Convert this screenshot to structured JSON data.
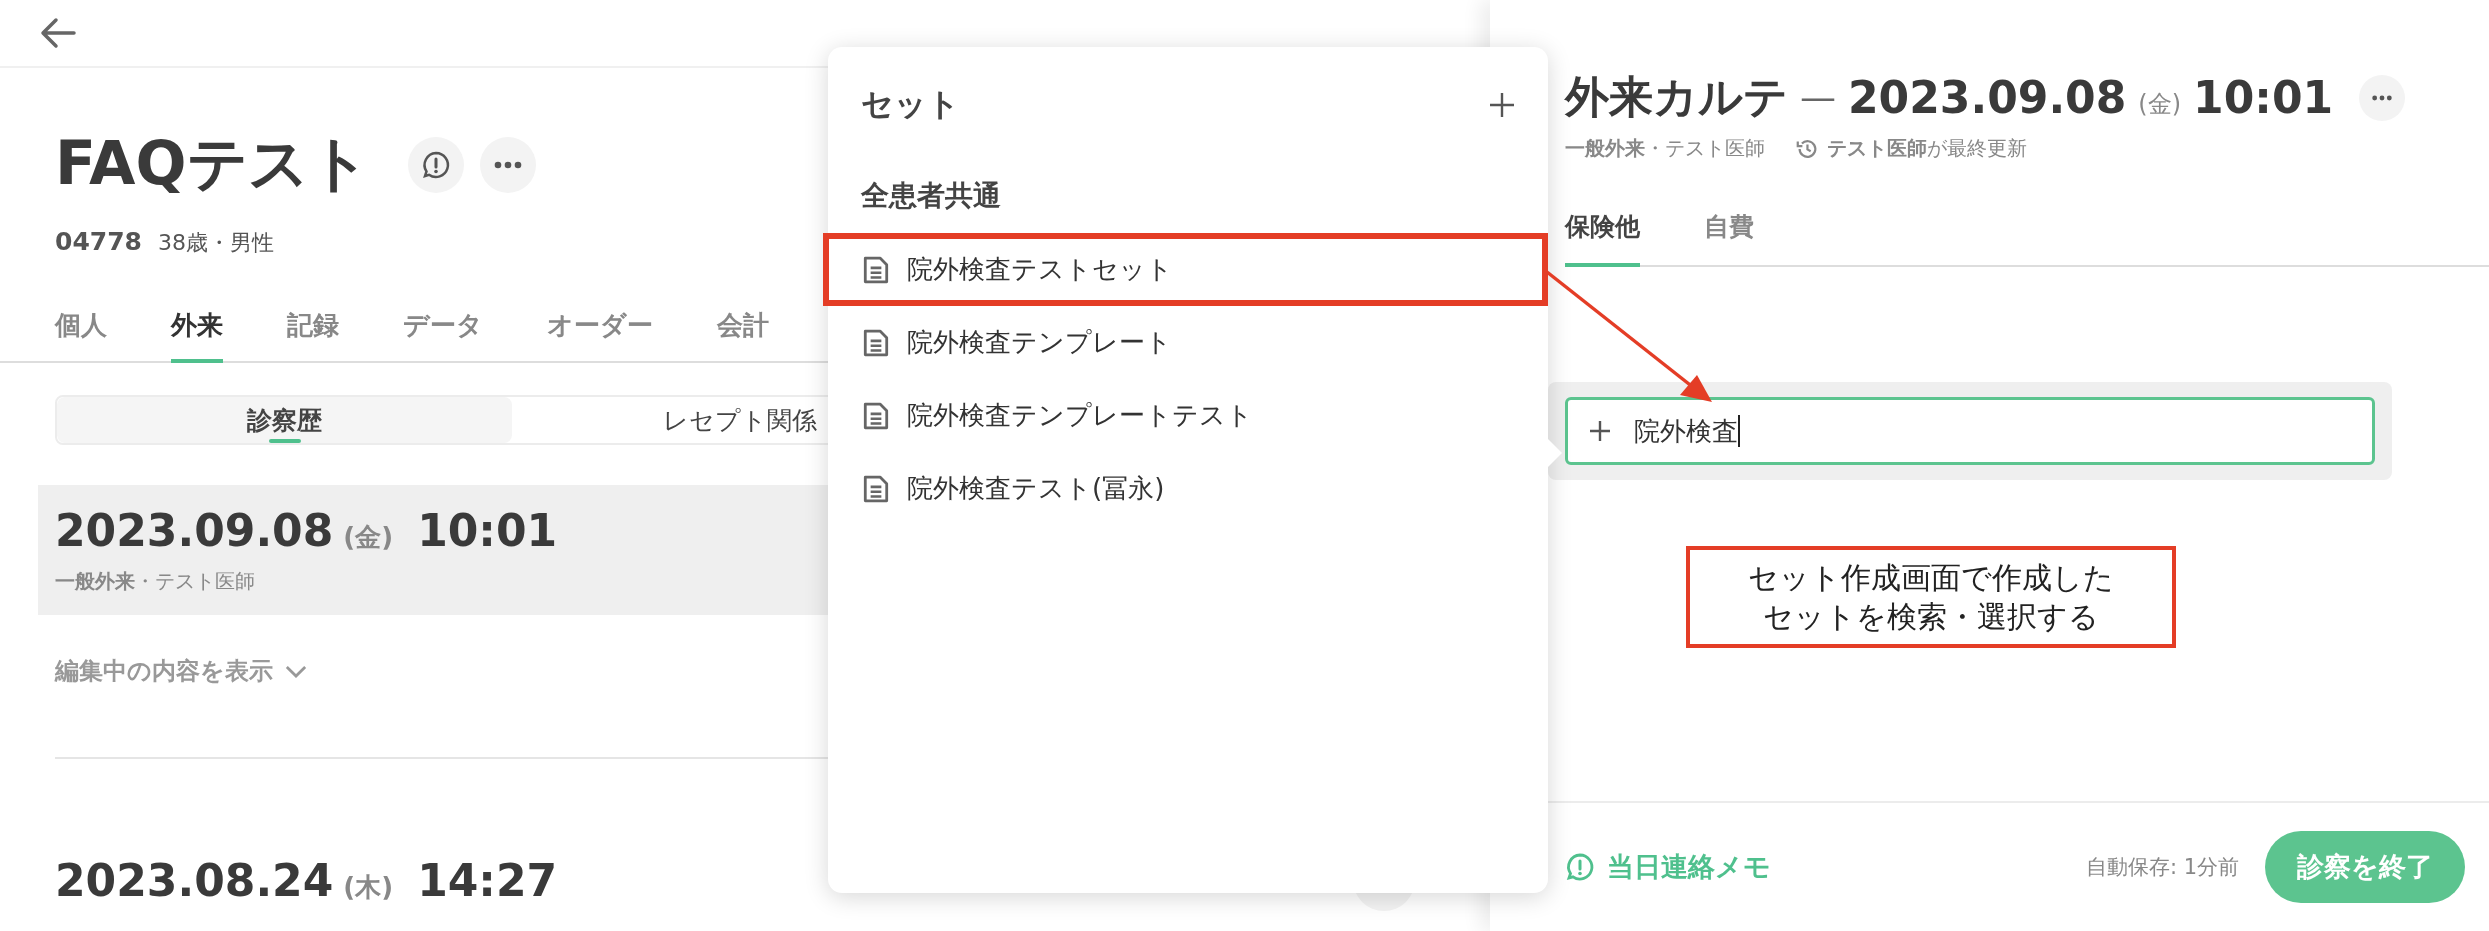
{
  "patient": {
    "name": "FAQテスト",
    "id": "04778",
    "age_sex": "38歳・男性"
  },
  "tabs": [
    {
      "label": "個人",
      "selected": false
    },
    {
      "label": "外来",
      "selected": true
    },
    {
      "label": "記録",
      "selected": false
    },
    {
      "label": "データ",
      "selected": false
    },
    {
      "label": "オーダー",
      "selected": false
    },
    {
      "label": "会計",
      "selected": false
    }
  ],
  "subtabs": [
    {
      "label": "診察歴",
      "selected": true
    },
    {
      "label": "レセプト関係",
      "selected": false
    }
  ],
  "visits": [
    {
      "date": "2023.09.08",
      "weekday": "(金)",
      "time": "10:01",
      "detail": "**一般外来**・テスト医師",
      "selected": true
    },
    {
      "date": "2023.08.24",
      "weekday": "(木)",
      "time": "14:27",
      "selected": false
    }
  ],
  "show_editing": "編集中の内容を表示",
  "set_menu": {
    "title": "セット",
    "group": "全患者共通",
    "items": [
      {
        "label": "院外検査テストセット",
        "marked": true
      },
      {
        "label": "院外検査テンプレート",
        "marked": false
      },
      {
        "label": "院外検査テンプレートテスト",
        "marked": false
      },
      {
        "label": "院外検査テスト(冨永)",
        "marked": false
      }
    ]
  },
  "chart": {
    "title": "外来カルテ",
    "dash": "—",
    "date": "2023.09.08",
    "weekday": "(金)",
    "time": "10:01",
    "detail": "**一般外来**・テスト医師",
    "updated": "**テスト医師**が最終更新",
    "tabs": [
      {
        "label": "保険他",
        "selected": true
      },
      {
        "label": "自費",
        "selected": false
      }
    ],
    "search_value": "院外検査"
  },
  "annotation": [
    "セット作成画面で作成した",
    "セットを検索・選択する"
  ],
  "footer": {
    "memo": "当日連絡メモ",
    "autosave": "自動保存: 1分前",
    "end_button": "診察を終了"
  }
}
